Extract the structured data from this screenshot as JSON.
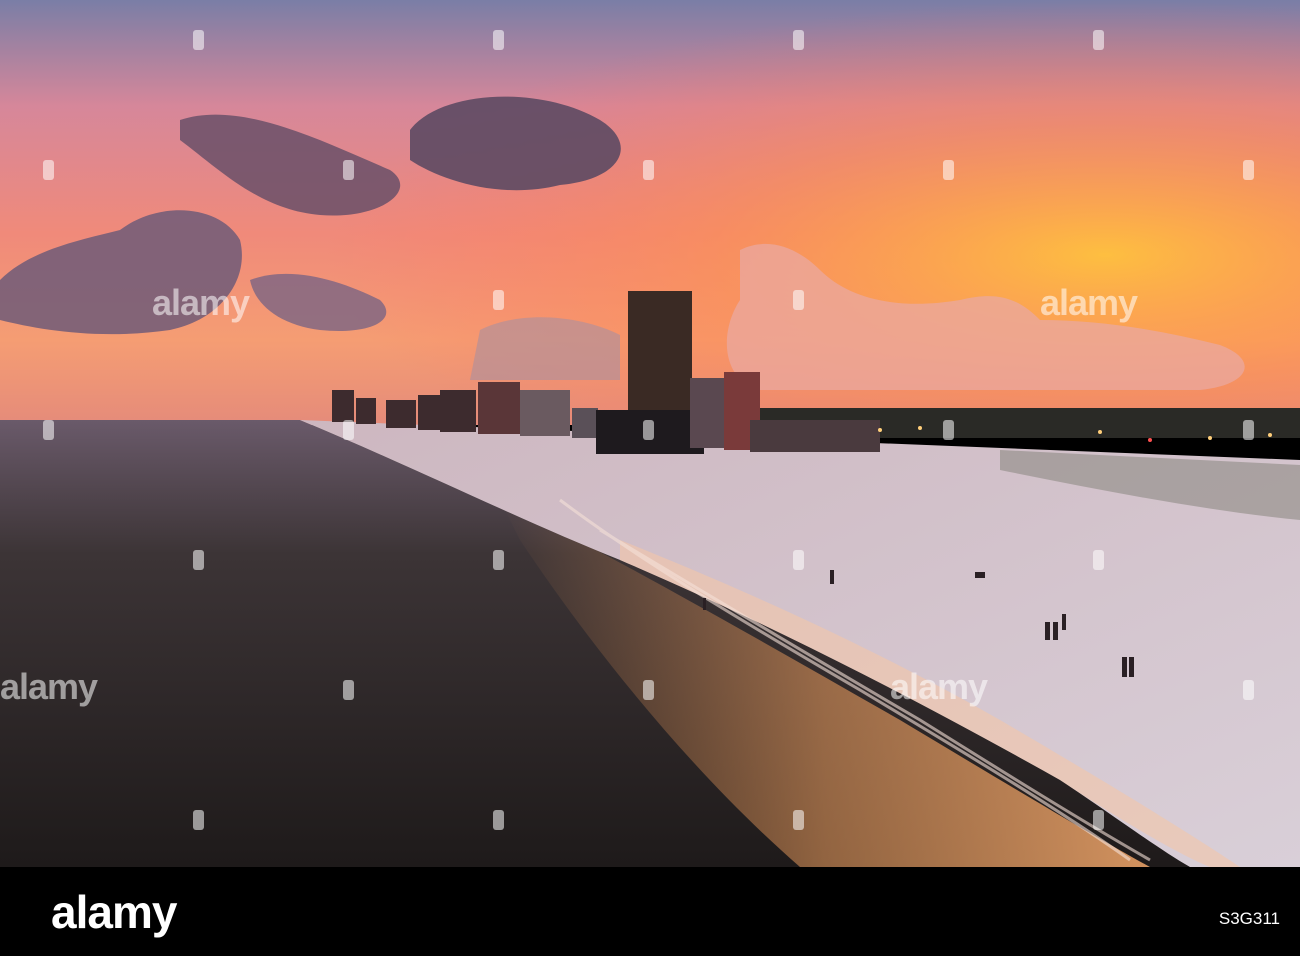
{
  "photo": {
    "subject": "sunset-over-beach-with-high-rise-condos",
    "colors": {
      "sky_top": "#8a7fa6",
      "sky_glow": "#ff9a4a",
      "cloud_purple": "#5a4560",
      "ocean": "#2c2a2a",
      "sand": "#cfc5d0"
    }
  },
  "watermark": {
    "text": "alamy"
  },
  "footer": {
    "logo": "alamy",
    "image_id": "S3G311"
  }
}
